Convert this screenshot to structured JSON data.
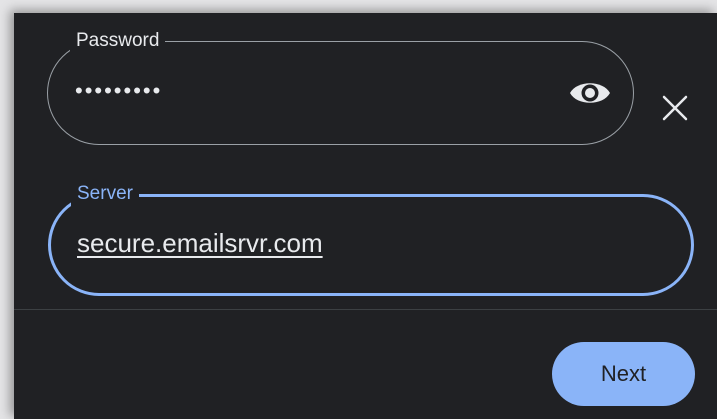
{
  "password": {
    "label": "Password",
    "masked_value": "•••••••••",
    "show_password_icon": "eye-icon",
    "clear_icon": "close-icon"
  },
  "server": {
    "label": "Server",
    "value": "secure.emailsrvr.com"
  },
  "actions": {
    "next_label": "Next"
  },
  "colors": {
    "background": "#202124",
    "accent": "#8ab4f8",
    "text": "#e8eaed",
    "outline": "#9aa0a6"
  }
}
